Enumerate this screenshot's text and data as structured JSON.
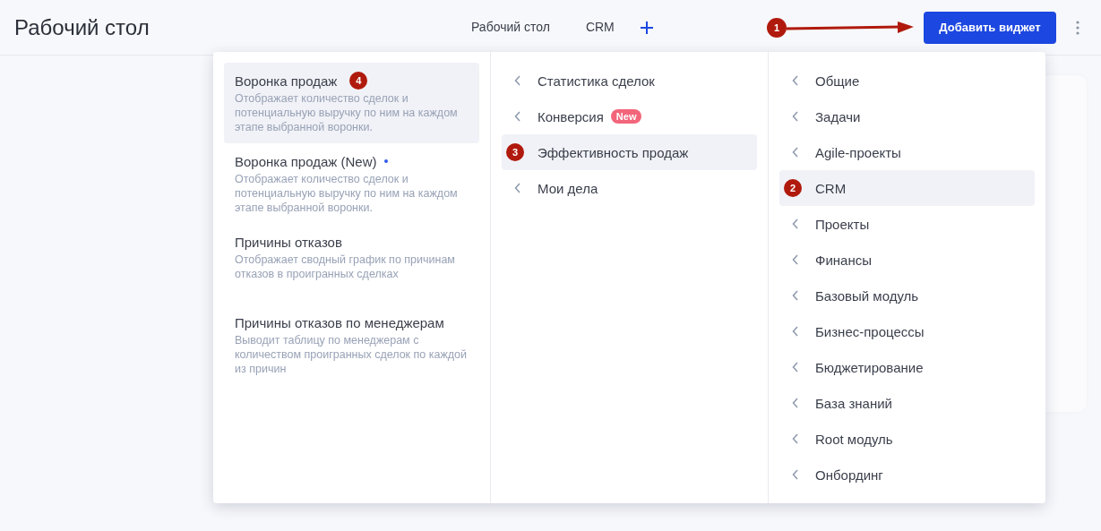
{
  "header": {
    "title": "Рабочий стол",
    "callout": "1",
    "add_widget_button": "Добавить виджет"
  },
  "tabs": [
    {
      "label": "Рабочий стол",
      "selected": false
    },
    {
      "label": "CRM",
      "selected": false
    }
  ],
  "widget_menu": {
    "widgets": [
      {
        "title": "Воронка продаж",
        "description": "Отображает количество сделок и потенциальную выручку по ним на каждом этапе выбранной воронки.",
        "selected": true,
        "marker": "4",
        "new_dot": false
      },
      {
        "title": "Воронка продаж (New)",
        "description": "Отображает количество сделок и потенциальную выручку по ним на каждом этапе выбранной воронки.",
        "selected": false,
        "new_dot": true
      },
      {
        "title": "Причины отказов",
        "description": "Отображает сводный график по причинам отказов в проигранных сделках",
        "selected": false,
        "new_dot": false
      },
      {
        "title": "Причины отказов по менеджерам",
        "description": "Выводит таблицу по менеджерам с количеством проигранных сделок по каждой из причин",
        "selected": false,
        "new_dot": false
      }
    ],
    "groups": [
      {
        "label": "Статистика сделок",
        "selected": false
      },
      {
        "label": "Конверсия",
        "tag": "New",
        "selected": false
      },
      {
        "label": "Эффективность продаж",
        "selected": true,
        "marker": "3"
      },
      {
        "label": "Мои дела",
        "selected": false
      }
    ],
    "modules": [
      {
        "label": "Общие",
        "selected": false
      },
      {
        "label": "Задачи",
        "selected": false
      },
      {
        "label": "Agile-проекты",
        "selected": false
      },
      {
        "label": "CRM",
        "selected": true,
        "marker": "2"
      },
      {
        "label": "Проекты",
        "selected": false
      },
      {
        "label": "Финансы",
        "selected": false
      },
      {
        "label": "Базовый модуль",
        "selected": false
      },
      {
        "label": "Бизнес-процессы",
        "selected": false
      },
      {
        "label": "Бюджетирование",
        "selected": false
      },
      {
        "label": "База знаний",
        "selected": false
      },
      {
        "label": "Root модуль",
        "selected": false
      },
      {
        "label": "Онбординг",
        "selected": false
      }
    ]
  }
}
